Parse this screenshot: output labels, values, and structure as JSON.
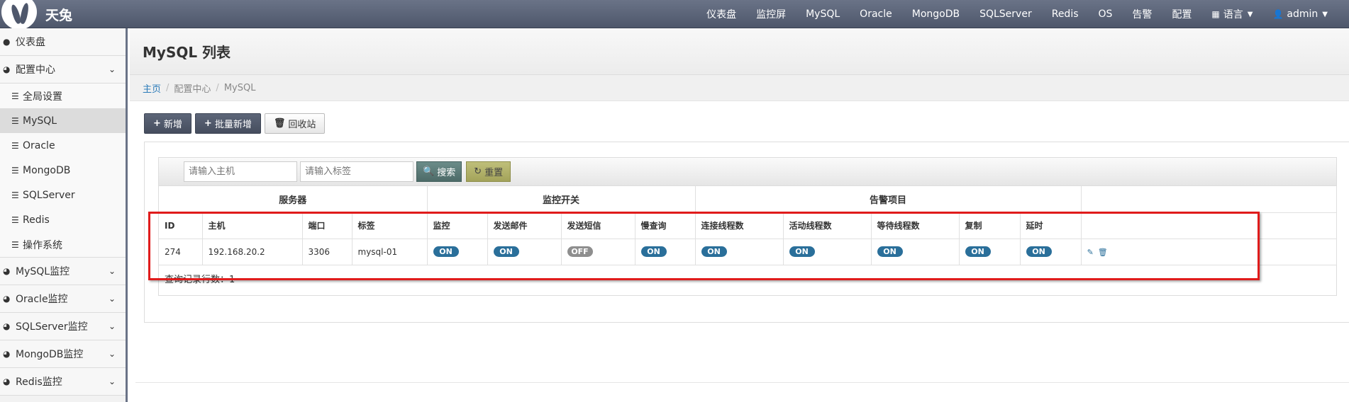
{
  "app": {
    "title": "天兔"
  },
  "nav": {
    "items": [
      "仪表盘",
      "监控屏",
      "MySQL",
      "Oracle",
      "MongoDB",
      "SQLServer",
      "Redis",
      "OS",
      "告警",
      "配置"
    ],
    "language": "语言",
    "user": "admin"
  },
  "sidebar": {
    "dashboard": "仪表盘",
    "config_center": "配置中心",
    "config_items": [
      "全局设置",
      "MySQL",
      "Oracle",
      "MongoDB",
      "SQLServer",
      "Redis",
      "操作系统"
    ],
    "active_item": "MySQL",
    "monitors": [
      "MySQL监控",
      "Oracle监控",
      "SQLServer监控",
      "MongoDB监控",
      "Redis监控"
    ]
  },
  "page": {
    "title": "MySQL 列表",
    "breadcrumb": [
      "主页",
      "配置中心",
      "MySQL"
    ]
  },
  "toolbar": {
    "add": "新增",
    "batch_add": "批量新增",
    "recycle": "回收站"
  },
  "filter": {
    "host_placeholder": "请输入主机",
    "tag_placeholder": "请输入标签",
    "search": "搜索",
    "reset": "重置"
  },
  "table": {
    "groups": [
      "服务器",
      "监控开关",
      "告警项目"
    ],
    "columns": [
      "ID",
      "主机",
      "端口",
      "标签",
      "监控",
      "发送邮件",
      "发送短信",
      "慢查询",
      "连接线程数",
      "活动线程数",
      "等待线程数",
      "复制",
      "延时"
    ],
    "rows": [
      {
        "id": "274",
        "host": "192.168.20.2",
        "port": "3306",
        "tag": "mysql-01",
        "switches": [
          "ON",
          "ON",
          "OFF",
          "ON",
          "ON",
          "ON",
          "ON",
          "ON",
          "ON"
        ]
      }
    ],
    "count_text": "查询记录行数：1"
  },
  "colors": {
    "navbar": "#4e576b",
    "toggle_on": "#2a6f9a",
    "toggle_off": "#8e8e8e",
    "highlight": "#e01b1b"
  }
}
